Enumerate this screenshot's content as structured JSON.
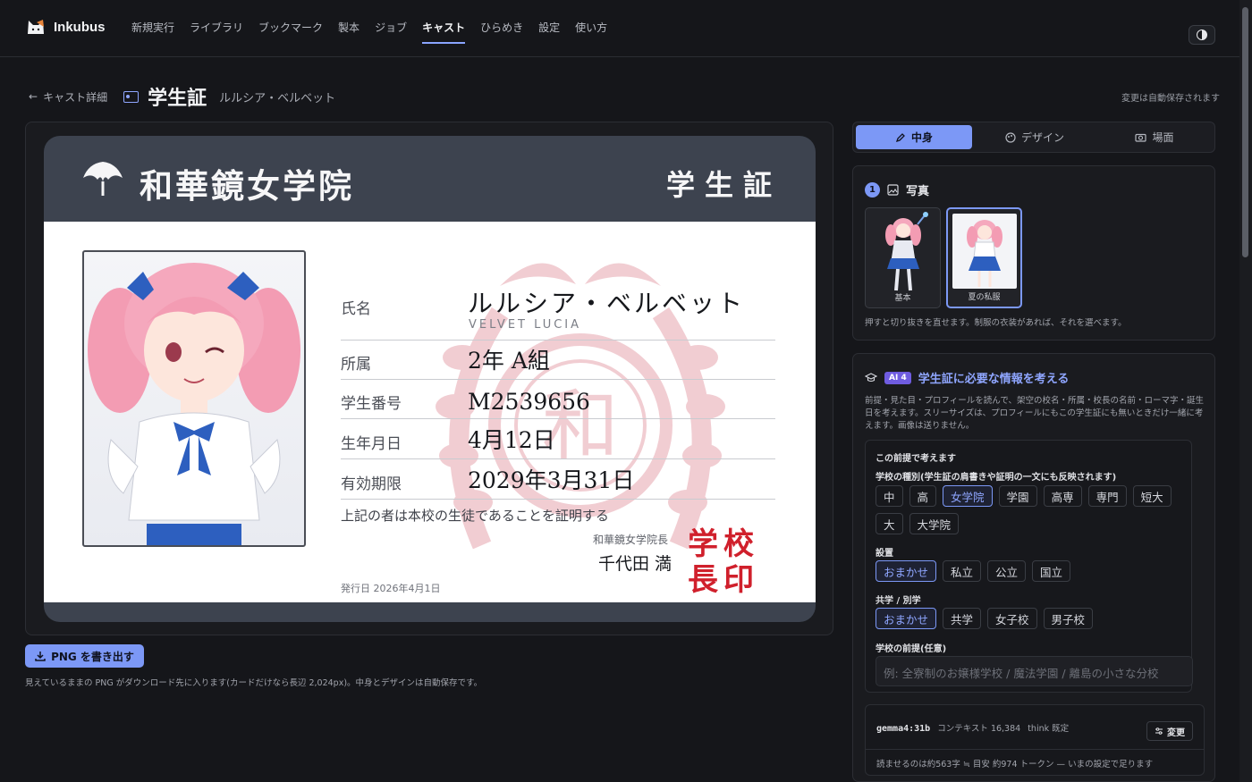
{
  "app": {
    "name": "Inkubus"
  },
  "nav": [
    {
      "label": "新規実行",
      "active": false
    },
    {
      "label": "ライブラリ",
      "active": false
    },
    {
      "label": "ブックマーク",
      "active": false
    },
    {
      "label": "製本",
      "active": false
    },
    {
      "label": "ジョブ",
      "active": false
    },
    {
      "label": "キャスト",
      "active": true
    },
    {
      "label": "ひらめき",
      "active": false
    },
    {
      "label": "設定",
      "active": false
    },
    {
      "label": "使い方",
      "active": false
    }
  ],
  "header": {
    "back_label": "キャスト詳細",
    "title": "学生証",
    "subtitle": "ルルシア・ベルベット",
    "autosave": "変更は自動保存されます"
  },
  "card": {
    "school_name": "和華鏡女学院",
    "card_type": "学生証",
    "watermark_char": "和",
    "rows": [
      {
        "label": "氏名",
        "value": "ルルシア・ベルベット"
      },
      {
        "label": "所属",
        "value": "2年 A組"
      },
      {
        "label": "学生番号",
        "value": "M2539656"
      },
      {
        "label": "生年月日",
        "value": "4月12日"
      },
      {
        "label": "有効期限",
        "value": "2029年3月31日"
      }
    ],
    "romaji": "VELVET LUCIA",
    "certification": "上記の者は本校の生徒であることを証明する",
    "principal_title": "和華鏡女学院長",
    "principal_name": "千代田 満",
    "seal_text": "学校長印",
    "issue_date": "発行日 2026年4月1日",
    "colors": {
      "header": "#3d434f",
      "accent_red": "#d0202c",
      "watermark": "#f0c8cd"
    }
  },
  "export": {
    "button_label": "PNG を書き出す",
    "note": "見えているままの PNG がダウンロード先に入ります(カードだけなら長辺 2,024px)。中身とデザインは自動保存です。"
  },
  "side_tabs": [
    {
      "label": "中身",
      "icon": "pencil-icon",
      "active": true
    },
    {
      "label": "デザイン",
      "icon": "palette-icon",
      "active": false
    },
    {
      "label": "場面",
      "icon": "camera-icon",
      "active": false
    }
  ],
  "photo_panel": {
    "step": "1",
    "title": "写真",
    "thumbs": [
      {
        "caption": "基本",
        "selected": false
      },
      {
        "caption": "夏の私服",
        "selected": true
      }
    ],
    "hint": "押すと切り抜きを直せます。制服の衣装があれば、それを選べます。"
  },
  "ai_panel": {
    "badge": "AI 4",
    "title": "学生証に必要な情報を考える",
    "description": "前提・見た目・プロフィールを読んで、架空の校名・所属・校長の名前・ローマ字・誕生日を考えます。スリーサイズは、プロフィールにもこの学生証にも無いときだけ一緒に考えます。画像は送りません。",
    "premise_heading": "この前提で考えます",
    "school_type": {
      "label": "学校の種別(学生証の肩書きや証明の一文にも反映されます)",
      "options": [
        "中",
        "高",
        "女学院",
        "学園",
        "高専",
        "専門",
        "短大",
        "大",
        "大学院"
      ],
      "selected": "女学院"
    },
    "establishment": {
      "label": "設置",
      "options": [
        "おまかせ",
        "私立",
        "公立",
        "国立"
      ],
      "selected": "おまかせ"
    },
    "coed": {
      "label": "共学 / 別学",
      "options": [
        "おまかせ",
        "共学",
        "女子校",
        "男子校"
      ],
      "selected": "おまかせ"
    },
    "premise_input": {
      "label": "学校の前提(任意)",
      "placeholder": "例: 全寮制のお嬢様学校 / 魔法学園 / 離島の小さな分校",
      "value": ""
    },
    "model": {
      "name": "gemma4:31b",
      "context": "コンテキスト 16,384",
      "think": "think 既定",
      "change_label": "変更",
      "estimate": "読ませるのは約563字 ≒ 目安 約974 トークン — いまの設定で足ります"
    }
  }
}
